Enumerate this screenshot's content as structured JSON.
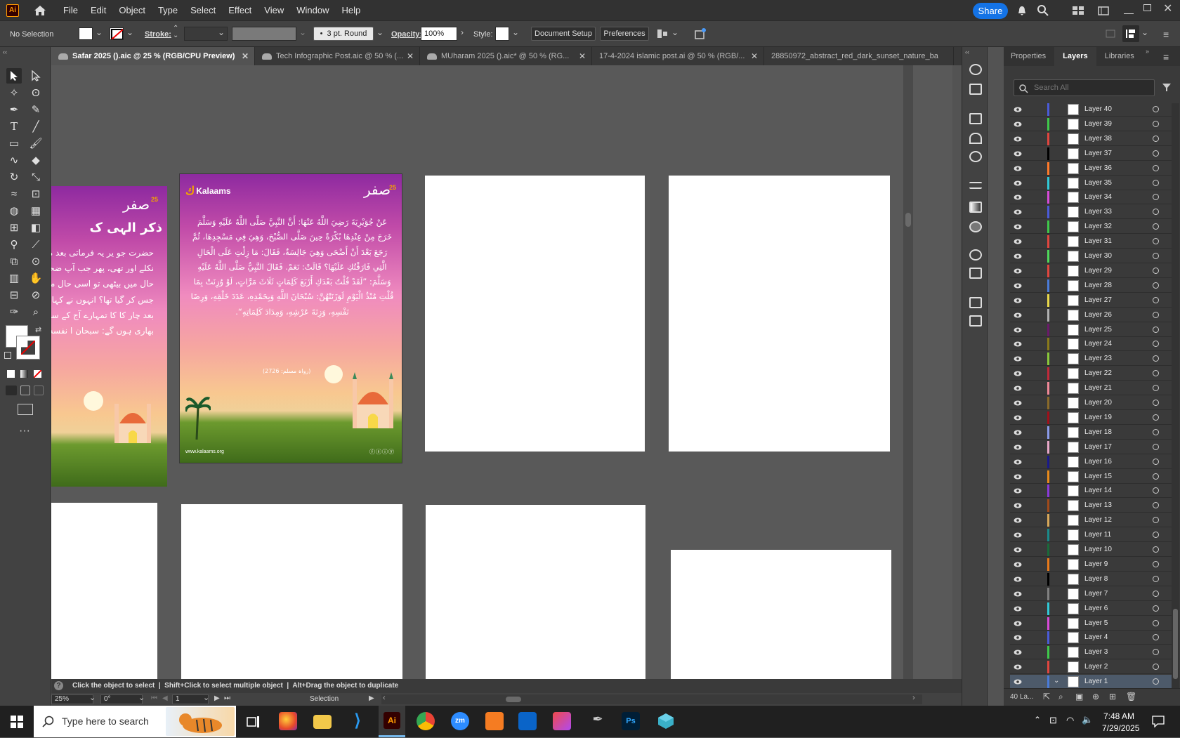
{
  "app": {
    "logo": "Ai",
    "share_label": "Share"
  },
  "menu": [
    "File",
    "Edit",
    "Object",
    "Type",
    "Select",
    "Effect",
    "View",
    "Window",
    "Help"
  ],
  "control": {
    "selection": "No Selection",
    "stroke_label": "Stroke:",
    "brush": "3 pt. Round",
    "opacity_label": "Opacity:",
    "opacity_value": "100%",
    "style_label": "Style:",
    "doc_setup": "Document Setup",
    "preferences": "Preferences"
  },
  "tabs": [
    {
      "label": "Safar 2025 ().aic @ 25 % (RGB/CPU Preview)",
      "active": true
    },
    {
      "label": "Tech Infographic Post.aic @ 50 % (...",
      "active": false
    },
    {
      "label": "MUharam 2025 ().aic* @ 50 % (RG...",
      "active": false
    },
    {
      "label": "17-4-2024 islamic post.ai @ 50 % (RGB/...",
      "active": false
    },
    {
      "label": "28850972_abstract_red_dark_sunset_nature_ba",
      "active": false
    }
  ],
  "poster": {
    "brand": "Kalaams",
    "logo_text": "صفر",
    "logo_num": "25",
    "arabic_body": "عَنْ جُوَيْرِيَةَ رَضِيَ اللَّهُ عَنْهَا: أَنَّ النَّبِيَّ صَلَّى اللَّهُ عَلَيْهِ وَسَلَّمَ خَرَجَ مِنْ عِنْدِهَا بُكْرَةً حِينَ صَلَّى الصُّبْحَ، وَهِيَ فِي مَسْجِدِهَا، ثُمَّ رَجَعَ بَعْدَ أَنْ أَضْحَى وَهِيَ جَالِسَةٌ، فَقَالَ: مَا زِلْتِ عَلَى الْحَالِ الَّتِي فَارَقْتُكِ عَلَيْهَا؟ قَالَتْ: نَعَمْ. فَقَالَ النَّبِيُّ صَلَّى اللَّهُ عَلَيْهِ وَسَلَّمَ: ”لَقَدْ قُلْتُ بَعْدَكِ أَرْبَعَ كَلِمَاتٍ ثَلَاثَ مَرَّاتٍ، لَوْ وُزِنَتْ بِمَا قُلْتِ مُنْذُ الْيَوْمِ لَوَزَنَتْهُنَّ: سُبْحَانَ اللَّهِ وَبِحَمْدِهِ، عَدَدَ خَلْقِهِ، وَرِضَا نَفْسِهِ، وَزِنَةَ عَرْشِهِ، وَمِدَادَ كَلِمَاتِهِ“.",
    "reference": "(رواہ مسلم: 2726)",
    "website": "www.kalaams.org",
    "urdu_title": "ذکر الہی ک",
    "urdu_body": "حضرت جو یر یہ فرماتی بعد میرے پاس سے نکلے اور تھی، پھر جب آپ ضحی میں اسی حال میں بیٹھی تو اسی حال میں بیٹھی ہو جس کر گیا تھا؟ انہوں نے کہا: میرے تمہارے بعد چار کا کا تمہارے آج کے سارے اذکا پر بھاری ہوں گے: سبحان ا نفسه، وزنة عر"
  },
  "panel": {
    "tabs": [
      "Properties",
      "Layers",
      "Libraries"
    ],
    "search_placeholder": "Search All",
    "footer_count": "40 La...",
    "layers": [
      {
        "name": "Layer 40",
        "color": "#4a5bd8"
      },
      {
        "name": "Layer 39",
        "color": "#3fc84a"
      },
      {
        "name": "Layer 38",
        "color": "#e0463f"
      },
      {
        "name": "Layer 37",
        "color": "#000000"
      },
      {
        "name": "Layer 36",
        "color": "#ff7a2a"
      },
      {
        "name": "Layer 35",
        "color": "#31c9d6"
      },
      {
        "name": "Layer 34",
        "color": "#d74ad8"
      },
      {
        "name": "Layer 33",
        "color": "#4a5bd8"
      },
      {
        "name": "Layer 32",
        "color": "#3fc84a"
      },
      {
        "name": "Layer 31",
        "color": "#e0463f"
      },
      {
        "name": "Layer 30",
        "color": "#4fd85a"
      },
      {
        "name": "Layer 29",
        "color": "#e0463f"
      },
      {
        "name": "Layer 28",
        "color": "#4a7bd8"
      },
      {
        "name": "Layer 27",
        "color": "#e8d84a"
      },
      {
        "name": "Layer 26",
        "color": "#b0b0b0"
      },
      {
        "name": "Layer 25",
        "color": "#6a1a6a"
      },
      {
        "name": "Layer 24",
        "color": "#8a7a1a"
      },
      {
        "name": "Layer 23",
        "color": "#8ac83a"
      },
      {
        "name": "Layer 22",
        "color": "#c02a3a"
      },
      {
        "name": "Layer 21",
        "color": "#f08898"
      },
      {
        "name": "Layer 20",
        "color": "#8a6a2a"
      },
      {
        "name": "Layer 19",
        "color": "#a0101a"
      },
      {
        "name": "Layer 18",
        "color": "#8a9ae8"
      },
      {
        "name": "Layer 17",
        "color": "#e8a8c8"
      },
      {
        "name": "Layer 16",
        "color": "#1a1a8a"
      },
      {
        "name": "Layer 15",
        "color": "#e88a1a"
      },
      {
        "name": "Layer 14",
        "color": "#8a3ad8"
      },
      {
        "name": "Layer 13",
        "color": "#a04a1a"
      },
      {
        "name": "Layer 12",
        "color": "#d8a85a"
      },
      {
        "name": "Layer 11",
        "color": "#1a8a8a"
      },
      {
        "name": "Layer 10",
        "color": "#1a6a3a"
      },
      {
        "name": "Layer 9",
        "color": "#e87a1a"
      },
      {
        "name": "Layer 8",
        "color": "#000000"
      },
      {
        "name": "Layer 7",
        "color": "#808080"
      },
      {
        "name": "Layer 6",
        "color": "#31c9d6"
      },
      {
        "name": "Layer 5",
        "color": "#d74ad8"
      },
      {
        "name": "Layer 4",
        "color": "#4a5bd8"
      },
      {
        "name": "Layer 3",
        "color": "#3fc84a"
      },
      {
        "name": "Layer 2",
        "color": "#e0463f"
      },
      {
        "name": "Layer 1",
        "color": "#4a7bd8"
      }
    ]
  },
  "status": {
    "hint": "Click the object to select  |  Shift+Click to select multiple object  |  Alt+Drag the object to duplicate",
    "zoom": "25%",
    "rotation": "0°",
    "artboard_num": "1",
    "tool_name": "Selection"
  },
  "taskbar": {
    "search_placeholder": "Type here to search",
    "time": "7:48 AM",
    "date": "7/29/2025"
  }
}
